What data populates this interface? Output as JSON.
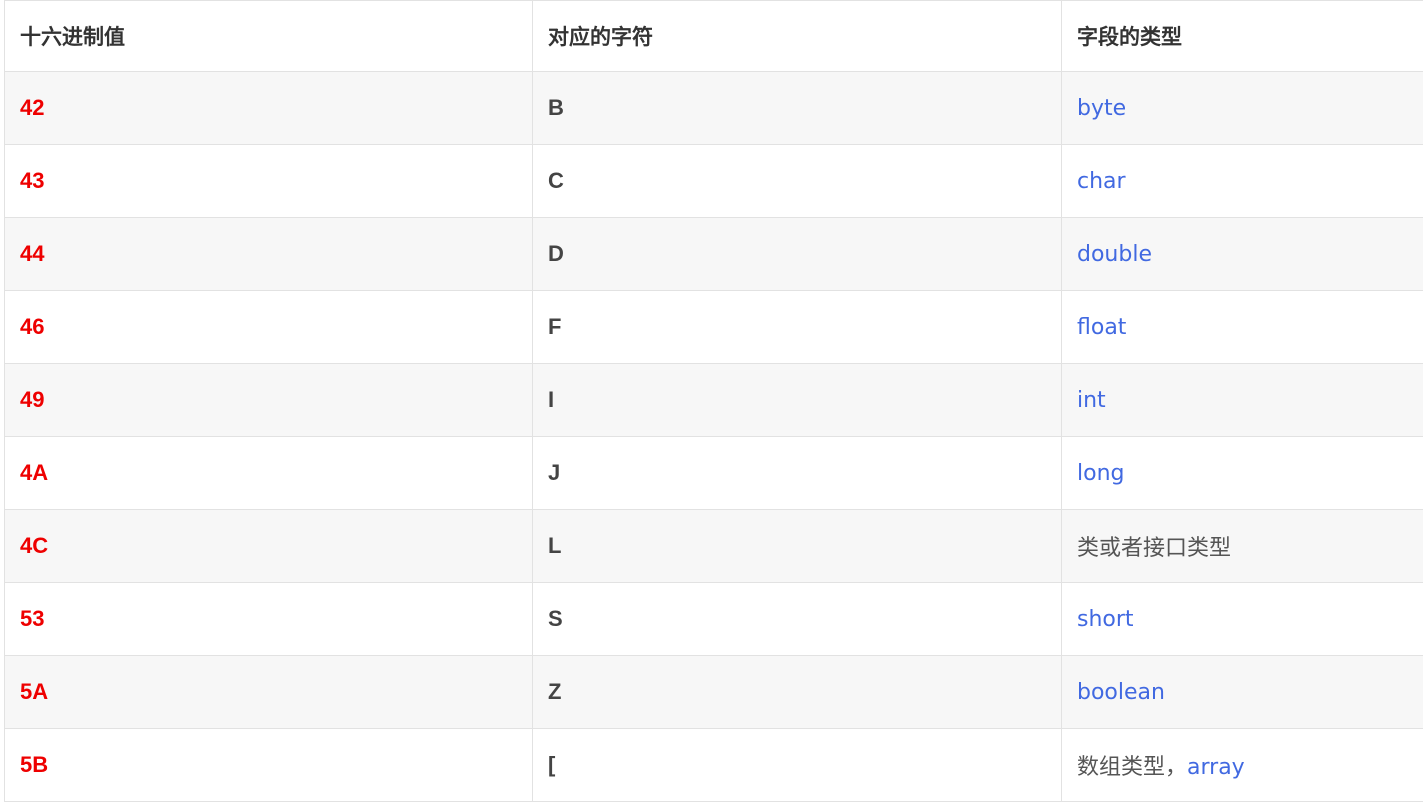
{
  "table": {
    "headers": [
      "十六进制值",
      "对应的字符",
      "字段的类型"
    ],
    "rows": [
      {
        "hex": "42",
        "char": "B",
        "type": {
          "text": "",
          "link": "byte"
        }
      },
      {
        "hex": "43",
        "char": "C",
        "type": {
          "text": "",
          "link": "char"
        }
      },
      {
        "hex": "44",
        "char": "D",
        "type": {
          "text": "",
          "link": "double"
        }
      },
      {
        "hex": "46",
        "char": "F",
        "type": {
          "text": "",
          "link": "float"
        }
      },
      {
        "hex": "49",
        "char": "I",
        "type": {
          "text": "",
          "link": "int"
        }
      },
      {
        "hex": "4A",
        "char": "J",
        "type": {
          "text": "",
          "link": "long"
        }
      },
      {
        "hex": "4C",
        "char": "L",
        "type": {
          "text": "类或者接口类型",
          "link": ""
        }
      },
      {
        "hex": "53",
        "char": "S",
        "type": {
          "text": "",
          "link": "short"
        }
      },
      {
        "hex": "5A",
        "char": "Z",
        "type": {
          "text": "",
          "link": "boolean"
        }
      },
      {
        "hex": "5B",
        "char": "[",
        "type": {
          "text": "数组类型，",
          "link": "array"
        }
      }
    ]
  },
  "colors": {
    "hex_text": "#ee0000",
    "link_text": "#4169e1",
    "stripe_bg": "#f7f7f7",
    "border": "#e2e2e2"
  }
}
